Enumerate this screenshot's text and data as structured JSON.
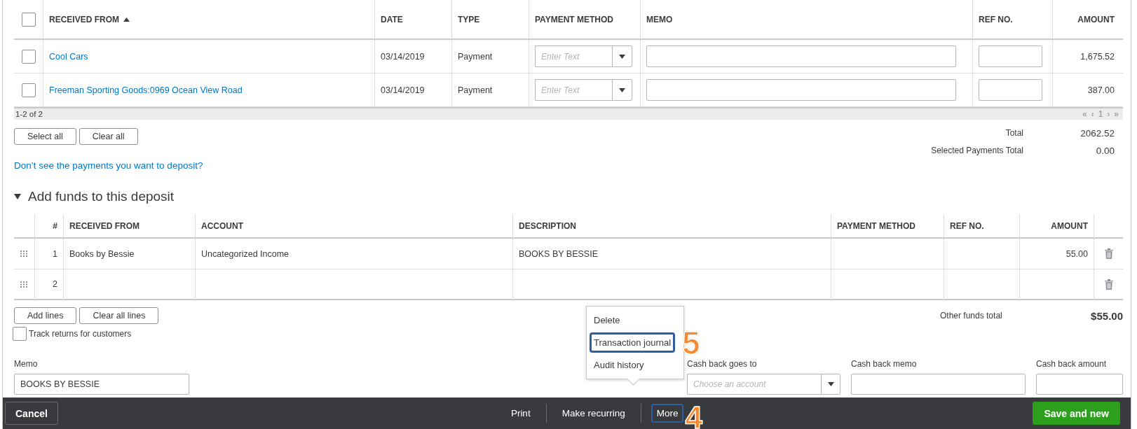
{
  "payments_table": {
    "select_all_checked": false,
    "columns": [
      {
        "label": "RECEIVED FROM",
        "sorted": true
      },
      {
        "label": "DATE",
        "sorted": false
      },
      {
        "label": "TYPE",
        "sorted": false
      },
      {
        "label": "PAYMENT METHOD",
        "sorted": false
      },
      {
        "label": "MEMO",
        "sorted": false
      },
      {
        "label": "REF NO.",
        "sorted": false
      },
      {
        "label": "AMOUNT",
        "sorted": false
      }
    ],
    "rows": [
      {
        "checked": false,
        "received_from": "Cool Cars",
        "date": "03/14/2019",
        "type": "Payment",
        "payment_method_placeholder": "Enter Text",
        "amount": "1,675.52"
      },
      {
        "checked": false,
        "received_from": "Freeman Sporting Goods:0969 Ocean View Road",
        "date": "03/14/2019",
        "type": "Payment",
        "payment_method_placeholder": "Enter Text",
        "amount": "387.00"
      }
    ],
    "range": "1-2 of 2",
    "pager": [
      "«",
      "‹",
      "1",
      "›",
      "»"
    ]
  },
  "selection_buttons": [
    "Select all",
    "Clear all"
  ],
  "totals": [
    {
      "label": "Total",
      "value": "2062.52"
    },
    {
      "label": "Selected Payments Total",
      "value": "0.00"
    }
  ],
  "help_link": "Don’t see the payments you want to deposit?",
  "section": {
    "title": "Add funds to this deposit",
    "expanded": true
  },
  "funds_table": {
    "columns": [
      "#",
      "RECEIVED FROM",
      "ACCOUNT",
      "DESCRIPTION",
      "PAYMENT METHOD",
      "REF NO.",
      "AMOUNT"
    ],
    "rows": [
      {
        "number": "1",
        "received_from": "Books by Bessie",
        "account": "Uncategorized Income",
        "description": "BOOKS BY BESSIE",
        "amount": "55.00"
      },
      {
        "number": "2"
      }
    ]
  },
  "line_buttons": [
    "Add lines",
    "Clear all lines"
  ],
  "other_funds_total": {
    "label": "Other funds total",
    "value": "$55.00"
  },
  "track_returns": {
    "label": "Track returns for customers",
    "checked": false
  },
  "memo": {
    "label": "Memo",
    "value": "BOOKS BY BESSIE"
  },
  "cash_back": [
    {
      "label": "Cash back goes to",
      "kind": "select",
      "placeholder": "Choose an account"
    },
    {
      "label": "Cash back memo",
      "kind": "textarea"
    },
    {
      "label": "Cash back amount",
      "kind": "input"
    }
  ],
  "more_menu": [
    {
      "label": "Delete",
      "highlighted": false
    },
    {
      "label": "Transaction journal",
      "highlighted": true,
      "callout": "5"
    },
    {
      "label": "Audit history",
      "highlighted": false
    }
  ],
  "footer": {
    "cancel": "Cancel",
    "actions": [
      {
        "label": "Print",
        "highlighted": false
      },
      {
        "label": "Make recurring",
        "highlighted": false
      },
      {
        "label": "More",
        "highlighted": true,
        "callout": "4"
      }
    ],
    "save": "Save and new"
  }
}
